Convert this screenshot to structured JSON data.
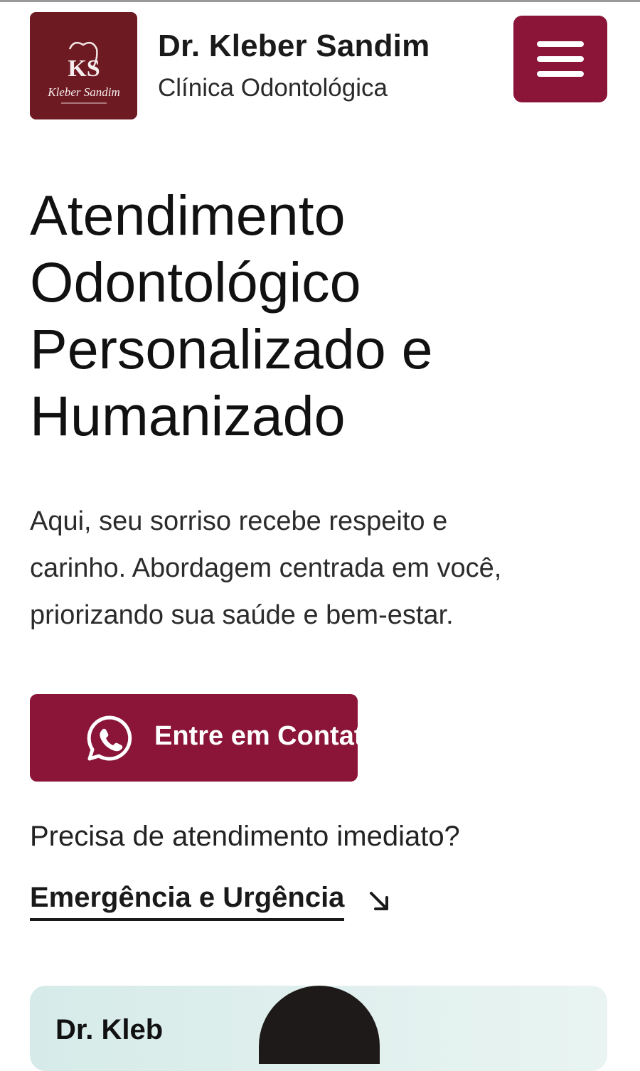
{
  "header": {
    "logo": {
      "monogram": "KS",
      "script_text": "Kleber Sandim",
      "background": "#6e1a22"
    },
    "brand_name": "Dr. Kleber Sandim",
    "brand_subtitle": "Clínica Odontológica",
    "menu_icon": "hamburger-menu-icon"
  },
  "hero": {
    "title_lines": [
      "Atendimento",
      "Odontológico",
      "Personalizado e",
      "Humanizado"
    ],
    "description_lines": [
      "Aqui, seu sorriso recebe respeito e",
      "carinho. Abordagem centrada em você,",
      "priorizando sua saúde e bem-estar."
    ],
    "cta": {
      "icon": "whatsapp-icon",
      "label": "Entre em Contato"
    },
    "urgent_question": "Precisa de atendimento imediato?",
    "emergency_link": {
      "label": "Emergência e Urgência",
      "icon": "arrow-down-right-icon"
    }
  },
  "doctor_card": {
    "name_partial": "Dr. Kleb"
  },
  "colors": {
    "brand_primary": "#8a1538",
    "logo_bg": "#6e1a22",
    "text": "#111111",
    "card_bg": "#d6ebe9"
  }
}
